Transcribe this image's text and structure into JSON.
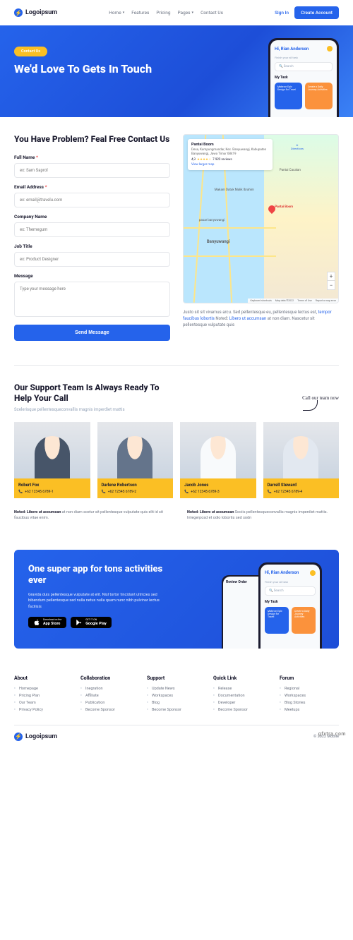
{
  "brand": "Logoipsum",
  "nav": {
    "home": "Home",
    "features": "Features",
    "pricing": "Pricing",
    "pages": "Pages",
    "contact": "Contact Us"
  },
  "auth": {
    "signin": "Sign In",
    "create": "Create Account"
  },
  "hero": {
    "badge": "Contact Us",
    "title": "We'd Love To Gets In Touch"
  },
  "phone": {
    "greeting": "Hi, Rian Anderson",
    "sub": "Finish your all task",
    "search": "Search",
    "label": "My Task",
    "card1": "Make an Epic Design for Travel",
    "card2": "Create a Daily Journey Activities",
    "review": "Review Order"
  },
  "contact": {
    "title": "You Have Problem? Feal Free Contact Us",
    "name_l": "Full Name",
    "name_p": "ex: Sam Saprol",
    "email_l": "Email Address",
    "email_p": "ex: email@travelu.com",
    "company_l": "Company Name",
    "company_p": "ex: Themegum",
    "job_l": "Job Title",
    "job_p": "ex: Product Designer",
    "msg_l": "Message",
    "msg_p": "Type your message here",
    "submit": "Send Message"
  },
  "map": {
    "title": "Pantai Boom",
    "addr": "Desa, Kampungmandar, Kec. Banyuwangi, Kabupaten Banyuwangi, Jawa Timur 68419",
    "rating": "4,3",
    "reviews": "7.922 reviews",
    "viewlarge": "View larger map",
    "directions": "Directions",
    "place1": "Makam Datuk Malik Ibrahim",
    "place2": "pasar banyuwangi",
    "city": "Banyuwangi",
    "beach": "Pantai Cacalan",
    "pinlabel": "Pantai Boom",
    "attrib1": "Keyboard shortcuts",
    "attrib2": "Map data ©2022",
    "attrib3": "Terms of Use",
    "attrib4": "Report a map error",
    "desc_pre": "Justo sit sit vivamus arcu. Sed pellentesque eu, pellentesque lectus est, ",
    "desc_link1": "tempor faucibus lobortis",
    "desc_mid": " Noted: ",
    "desc_link2": "Libero ut accumsan",
    "desc_post": " at non diam. Nascetur sit pellentesque vulputate quis"
  },
  "support": {
    "title": "Our Support Team Is Always Ready To Help Your Call",
    "sub": "Scelerisque pellentesqueconvallis magnis imperdiet mattis",
    "hand": "Call our team now",
    "team": [
      {
        "name": "Robert Fox",
        "phone": "+62 12345 6789-1"
      },
      {
        "name": "Darlene Robertson",
        "phone": "+62 12345 6789-2"
      },
      {
        "name": "Jacob Jones",
        "phone": "+62 12345 6789-3"
      },
      {
        "name": "Darrell Steward",
        "phone": "+62 12345 6789-4"
      }
    ],
    "note1_b": "Noted: Libero ut accumsan",
    "note1": " at non diam scetur sit pellentesque vulputate quis elit id sit faucibus vitae enim.",
    "note2_b": "Noted: Libero ut accumsan",
    "note2": " Sociis pellentesqueconvallis magnis imperdiet mattis. Integerposd et odio lobortis sed sodn"
  },
  "cta": {
    "title": "One super app for tons activities ever",
    "sub": "Gravida duis pellentesque vulputate at elit. Nisl tortor tincidunt ultricies sed bibendum pellentesque sed nulla netus nulla quam nunc nibh pulvinar lectus facilisis",
    "apple_top": "Download on the",
    "apple": "App Store",
    "google_top": "GET IT ON",
    "google": "Google Play"
  },
  "footer": {
    "cols": [
      {
        "h": "About",
        "items": [
          "Homepage",
          "Pricing Plan",
          "Our Team",
          "Privacy Policy"
        ]
      },
      {
        "h": "Collaboration",
        "items": [
          "Inegration",
          "Affiliate",
          "Publication",
          "Become Sponsor"
        ]
      },
      {
        "h": "Support",
        "items": [
          "Update News",
          "Workspaces",
          "Blog",
          "Become Sponsor"
        ]
      },
      {
        "h": "Quick Link",
        "items": [
          "Release",
          "Documentation",
          "Developer",
          "Become Sponsor"
        ]
      },
      {
        "h": "Forum",
        "items": [
          "Regional",
          "Workspaces",
          "Blog Stories",
          "Meetups"
        ]
      }
    ],
    "copy": "© 2022 Mobile"
  },
  "watermark": "gfxtra.com"
}
